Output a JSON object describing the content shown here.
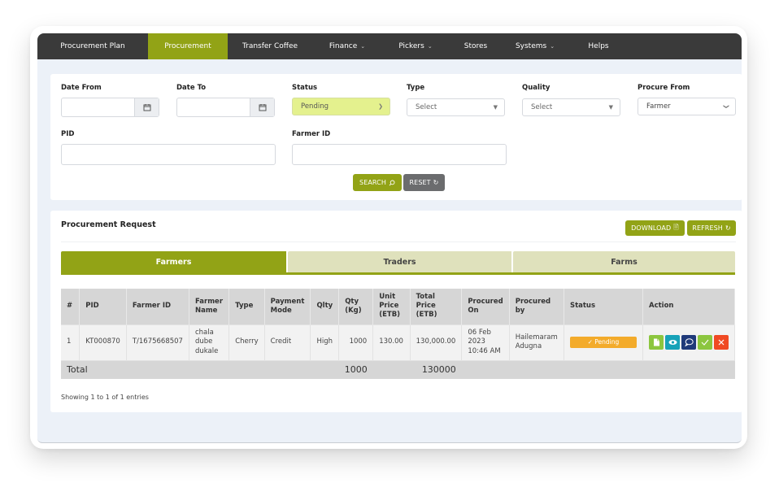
{
  "nav": {
    "items": [
      {
        "label": "Procurement Plan",
        "dropdown": false,
        "active": false
      },
      {
        "label": "Procurement",
        "dropdown": false,
        "active": true
      },
      {
        "label": "Transfer Coffee",
        "dropdown": false,
        "active": false
      },
      {
        "label": "Finance",
        "dropdown": true,
        "active": false
      },
      {
        "label": "Pickers",
        "dropdown": true,
        "active": false
      },
      {
        "label": "Stores",
        "dropdown": false,
        "active": false
      },
      {
        "label": "Systems",
        "dropdown": true,
        "active": false
      },
      {
        "label": "Helps",
        "dropdown": false,
        "active": false
      }
    ]
  },
  "filters": {
    "date_from": {
      "label": "Date From",
      "value": ""
    },
    "date_to": {
      "label": "Date To",
      "value": ""
    },
    "status": {
      "label": "Status",
      "value": "Pending"
    },
    "type": {
      "label": "Type",
      "value": "Select"
    },
    "quality": {
      "label": "Quality",
      "value": "Select"
    },
    "procure_from": {
      "label": "Procure From",
      "value": "Farmer"
    },
    "pid": {
      "label": "PID",
      "value": ""
    },
    "farmer_id": {
      "label": "Farmer ID",
      "value": ""
    },
    "search_label": "SEARCH",
    "reset_label": "RESET"
  },
  "request": {
    "title": "Procurement Request",
    "download_label": "DOWNLOAD",
    "refresh_label": "REFRESH",
    "tabs": [
      {
        "label": "Farmers",
        "active": true
      },
      {
        "label": "Traders",
        "active": false
      },
      {
        "label": "Farms",
        "active": false
      }
    ],
    "columns": [
      "#",
      "PID",
      "Farmer ID",
      "Farmer Name",
      "Type",
      "Payment Mode",
      "Qlty",
      "Qty (Kg)",
      "Unit Price (ETB)",
      "Total Price (ETB)",
      "Procured On",
      "Procured by",
      "Status",
      "Action"
    ],
    "rows": [
      {
        "index": "1",
        "pid": "KT000870",
        "farmer_id": "T/1675668507",
        "farmer_name": "chala dube dukale",
        "type": "Cherry",
        "payment_mode": "Credit",
        "quality": "High",
        "qty": "1000",
        "unit_price": "130.00",
        "total_price": "130,000.00",
        "procured_on": "06 Feb 2023 10:46 AM",
        "procured_by": "Hailemaram Adugna",
        "status": "✓ Pending"
      }
    ],
    "total": {
      "label": "Total",
      "qty": "1000",
      "total_price": "130000"
    },
    "showing": "Showing 1 to 1 of 1 entries"
  },
  "colors": {
    "brand": "#92a316",
    "nav_bg": "#3a3a3a",
    "pending": "#f3ab2b",
    "action_doc": "#8cc63f",
    "action_view": "#17a2b8",
    "action_comment": "#1f3a7a",
    "action_approve": "#8cc63f",
    "action_reject": "#f04a23"
  }
}
